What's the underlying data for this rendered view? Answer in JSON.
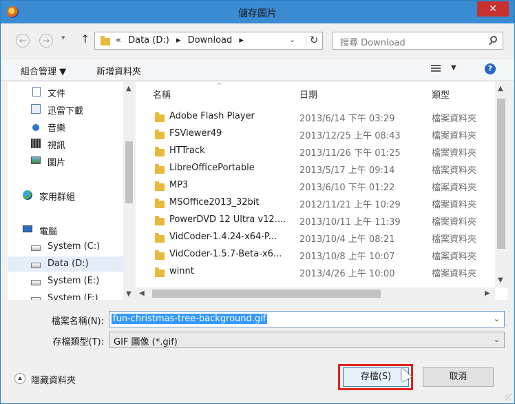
{
  "window": {
    "title": "儲存圖片",
    "close_label": "✕"
  },
  "address": {
    "back_label": "←",
    "forward_label": "→",
    "recent_label": "▾",
    "up_label": "↑",
    "crumbs": [
      "«",
      "Data (D:)",
      "▸",
      "Download",
      "▸"
    ],
    "dropdown_label": "⌄",
    "refresh_label": "↻"
  },
  "search": {
    "placeholder": "搜尋 Download"
  },
  "toolbar": {
    "organize_label": "組合管理 ▼",
    "new_folder_label": "新增資料夾",
    "view_dd": "▼",
    "help": "?"
  },
  "nav": {
    "items": [
      {
        "label": "文件",
        "icon": "document-icon"
      },
      {
        "label": "迅雷下載",
        "icon": "download-library-icon"
      },
      {
        "label": "音樂",
        "icon": "music-icon"
      },
      {
        "label": "視訊",
        "icon": "video-icon"
      },
      {
        "label": "圖片",
        "icon": "pictures-icon"
      },
      {
        "label": "家用群組",
        "icon": "homegroup-icon"
      },
      {
        "label": "電腦",
        "icon": "computer-icon"
      },
      {
        "label": "System (C:)",
        "icon": "drive-icon"
      },
      {
        "label": "Data (D:)",
        "icon": "drive-icon",
        "selected": true
      },
      {
        "label": "System (E:)",
        "icon": "drive-icon"
      },
      {
        "label": "System (F:)",
        "icon": "drive-icon"
      }
    ]
  },
  "columns": {
    "name": "名稱",
    "date": "日期",
    "type": "類型",
    "sort_indicator": "^"
  },
  "files": [
    {
      "name": "Adobe Flash Player",
      "date": "2013/6/14 下午 03:29",
      "type": "檔案資料夾"
    },
    {
      "name": "FSViewer49",
      "date": "2013/12/25 上午 08:43",
      "type": "檔案資料夾"
    },
    {
      "name": "HTTrack",
      "date": "2013/11/26 下午 01:25",
      "type": "檔案資料夾"
    },
    {
      "name": "LibreOfficePortable",
      "date": "2013/5/17 上午 09:14",
      "type": "檔案資料夾"
    },
    {
      "name": "MP3",
      "date": "2013/6/10 下午 01:22",
      "type": "檔案資料夾"
    },
    {
      "name": "MSOffice2013_32bit",
      "date": "2012/11/21 上午 10:29",
      "type": "檔案資料夾"
    },
    {
      "name": "PowerDVD 12 Ultra v12....",
      "date": "2013/10/11 上午 11:39",
      "type": "檔案資料夾"
    },
    {
      "name": "VidCoder-1.4.24-x64-P...",
      "date": "2013/10/4 上午 08:21",
      "type": "檔案資料夾"
    },
    {
      "name": "VidCoder-1.5.7-Beta-x6...",
      "date": "2013/10/8 上午 10:07",
      "type": "檔案資料夾"
    },
    {
      "name": "winnt",
      "date": "2013/4/26 上午 10:00",
      "type": "檔案資料夾"
    }
  ],
  "form": {
    "filename_label": "檔案名稱(N):",
    "filename_value": "fun-christmas-tree-background.gif",
    "filetype_label": "存檔類型(T):",
    "filetype_value": "GIF 圖像 (*.gif)",
    "dd": "⌄"
  },
  "footer": {
    "hide_folders_label": "隱藏資料夾",
    "save_label": "存檔(S)",
    "cancel_label": "取消"
  },
  "colors": {
    "titlebar": "#3b8bd3",
    "close": "#c7312f",
    "selection": "#3399ff",
    "highlight": "#e0231c"
  }
}
